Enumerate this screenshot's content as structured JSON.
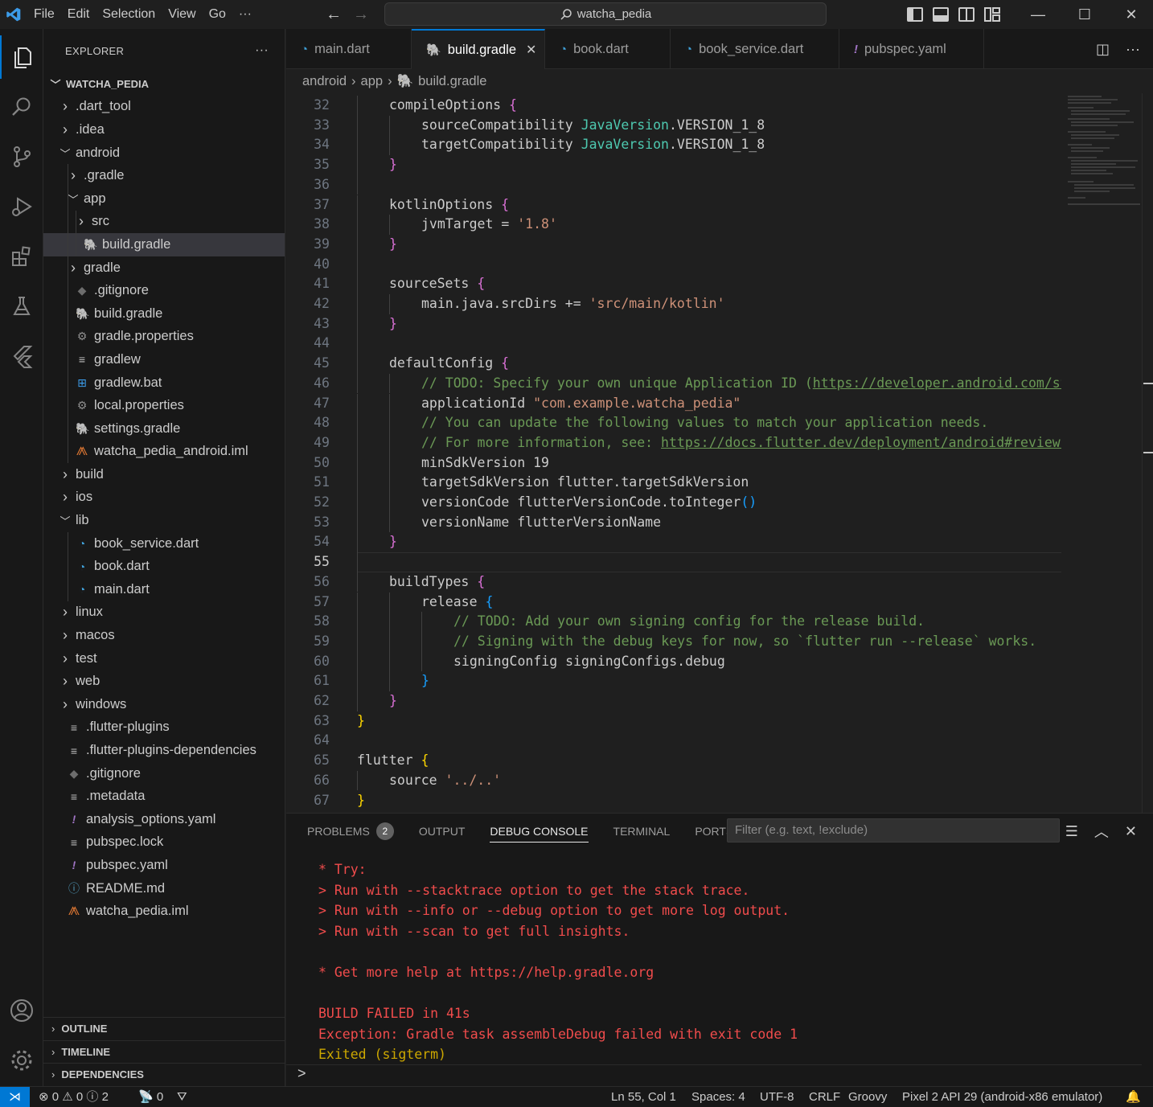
{
  "menu": [
    "File",
    "Edit",
    "Selection",
    "View",
    "Go",
    "···"
  ],
  "search": {
    "text": "watcha_pedia"
  },
  "window": {
    "minimize": "—",
    "maximize": "☐",
    "close": "✕"
  },
  "explorer": {
    "title": "EXPLORER",
    "more": "···",
    "root": "WATCHA_PEDIA"
  },
  "tree": [
    {
      "label": ".dart_tool",
      "depth": 1,
      "type": "folder",
      "open": false
    },
    {
      "label": ".idea",
      "depth": 1,
      "type": "folder",
      "open": false
    },
    {
      "label": "android",
      "depth": 1,
      "type": "folder",
      "open": true
    },
    {
      "label": ".gradle",
      "depth": 2,
      "type": "folder",
      "open": false
    },
    {
      "label": "app",
      "depth": 2,
      "type": "folder",
      "open": true
    },
    {
      "label": "src",
      "depth": 3,
      "type": "folder",
      "open": false
    },
    {
      "label": "build.gradle",
      "depth": 3,
      "type": "gradle",
      "selected": true
    },
    {
      "label": "gradle",
      "depth": 2,
      "type": "folder",
      "open": false
    },
    {
      "label": ".gitignore",
      "depth": 2,
      "type": "git"
    },
    {
      "label": "build.gradle",
      "depth": 2,
      "type": "gradle"
    },
    {
      "label": "gradle.properties",
      "depth": 2,
      "type": "gear"
    },
    {
      "label": "gradlew",
      "depth": 2,
      "type": "lines"
    },
    {
      "label": "gradlew.bat",
      "depth": 2,
      "type": "windows"
    },
    {
      "label": "local.properties",
      "depth": 2,
      "type": "gear"
    },
    {
      "label": "settings.gradle",
      "depth": 2,
      "type": "gradle"
    },
    {
      "label": "watcha_pedia_android.iml",
      "depth": 2,
      "type": "rss"
    },
    {
      "label": "build",
      "depth": 1,
      "type": "folder",
      "open": false
    },
    {
      "label": "ios",
      "depth": 1,
      "type": "folder",
      "open": false
    },
    {
      "label": "lib",
      "depth": 1,
      "type": "folder",
      "open": true
    },
    {
      "label": "book_service.dart",
      "depth": 2,
      "type": "dart"
    },
    {
      "label": "book.dart",
      "depth": 2,
      "type": "dart"
    },
    {
      "label": "main.dart",
      "depth": 2,
      "type": "dart"
    },
    {
      "label": "linux",
      "depth": 1,
      "type": "folder",
      "open": false
    },
    {
      "label": "macos",
      "depth": 1,
      "type": "folder",
      "open": false
    },
    {
      "label": "test",
      "depth": 1,
      "type": "folder",
      "open": false
    },
    {
      "label": "web",
      "depth": 1,
      "type": "folder",
      "open": false
    },
    {
      "label": "windows",
      "depth": 1,
      "type": "folder",
      "open": false
    },
    {
      "label": ".flutter-plugins",
      "depth": 1,
      "type": "lines"
    },
    {
      "label": ".flutter-plugins-dependencies",
      "depth": 1,
      "type": "lines"
    },
    {
      "label": ".gitignore",
      "depth": 1,
      "type": "git"
    },
    {
      "label": ".metadata",
      "depth": 1,
      "type": "lines"
    },
    {
      "label": "analysis_options.yaml",
      "depth": 1,
      "type": "yaml"
    },
    {
      "label": "pubspec.lock",
      "depth": 1,
      "type": "lines"
    },
    {
      "label": "pubspec.yaml",
      "depth": 1,
      "type": "yaml"
    },
    {
      "label": "README.md",
      "depth": 1,
      "type": "info"
    },
    {
      "label": "watcha_pedia.iml",
      "depth": 1,
      "type": "rss"
    }
  ],
  "sections": [
    "OUTLINE",
    "TIMELINE",
    "DEPENDENCIES"
  ],
  "tabs": [
    {
      "label": "main.dart",
      "type": "dart",
      "active": false
    },
    {
      "label": "build.gradle",
      "type": "gradle",
      "active": true
    },
    {
      "label": "book.dart",
      "type": "dart",
      "active": false
    },
    {
      "label": "book_service.dart",
      "type": "dart",
      "active": false
    },
    {
      "label": "pubspec.yaml",
      "type": "yaml",
      "active": false
    }
  ],
  "breadcrumb": [
    "android",
    "app",
    "build.gradle"
  ],
  "editor": {
    "current_line": 55,
    "lines": [
      {
        "n": 32,
        "ind": 1,
        "parts": [
          [
            "k",
            "compileOptions "
          ],
          [
            "b2",
            "{"
          ]
        ]
      },
      {
        "n": 33,
        "ind": 2,
        "parts": [
          [
            "k",
            "sourceCompatibility "
          ],
          [
            "t",
            "JavaVersion"
          ],
          [
            "k",
            ".VERSION_1_8"
          ]
        ]
      },
      {
        "n": 34,
        "ind": 2,
        "parts": [
          [
            "k",
            "targetCompatibility "
          ],
          [
            "t",
            "JavaVersion"
          ],
          [
            "k",
            ".VERSION_1_8"
          ]
        ]
      },
      {
        "n": 35,
        "ind": 1,
        "parts": [
          [
            "b2",
            "}"
          ]
        ]
      },
      {
        "n": 36,
        "ind": 0,
        "parts": []
      },
      {
        "n": 37,
        "ind": 1,
        "parts": [
          [
            "k",
            "kotlinOptions "
          ],
          [
            "b2",
            "{"
          ]
        ]
      },
      {
        "n": 38,
        "ind": 2,
        "parts": [
          [
            "k",
            "jvmTarget = "
          ],
          [
            "s",
            "'1.8'"
          ]
        ]
      },
      {
        "n": 39,
        "ind": 1,
        "parts": [
          [
            "b2",
            "}"
          ]
        ]
      },
      {
        "n": 40,
        "ind": 0,
        "parts": []
      },
      {
        "n": 41,
        "ind": 1,
        "parts": [
          [
            "k",
            "sourceSets "
          ],
          [
            "b2",
            "{"
          ]
        ]
      },
      {
        "n": 42,
        "ind": 2,
        "parts": [
          [
            "k",
            "main.java.srcDirs += "
          ],
          [
            "s",
            "'src/main/kotlin'"
          ]
        ]
      },
      {
        "n": 43,
        "ind": 1,
        "parts": [
          [
            "b2",
            "}"
          ]
        ]
      },
      {
        "n": 44,
        "ind": 0,
        "parts": []
      },
      {
        "n": 45,
        "ind": 1,
        "parts": [
          [
            "k",
            "defaultConfig "
          ],
          [
            "b2",
            "{"
          ]
        ]
      },
      {
        "n": 46,
        "ind": 2,
        "parts": [
          [
            "c",
            "// TODO: Specify your own unique Application ID ("
          ],
          [
            "u",
            "https://developer.android.com/studio/build/application-id.html"
          ],
          [
            "c",
            ")."
          ]
        ]
      },
      {
        "n": 47,
        "ind": 2,
        "parts": [
          [
            "k",
            "applicationId "
          ],
          [
            "s",
            "\"com.example.watcha_pedia\""
          ]
        ]
      },
      {
        "n": 48,
        "ind": 2,
        "parts": [
          [
            "c",
            "// You can update the following values to match your application needs."
          ]
        ]
      },
      {
        "n": 49,
        "ind": 2,
        "parts": [
          [
            "c",
            "// For more information, see: "
          ],
          [
            "u",
            "https://docs.flutter.dev/deployment/android#reviewing-the-gradle-build-configuration"
          ],
          [
            "c",
            "."
          ]
        ]
      },
      {
        "n": 50,
        "ind": 2,
        "parts": [
          [
            "k",
            "minSdkVersion 19"
          ]
        ]
      },
      {
        "n": 51,
        "ind": 2,
        "parts": [
          [
            "k",
            "targetSdkVersion flutter.targetSdkVersion"
          ]
        ]
      },
      {
        "n": 52,
        "ind": 2,
        "parts": [
          [
            "k",
            "versionCode flutterVersionCode.toInteger"
          ],
          [
            "b3",
            "()"
          ]
        ]
      },
      {
        "n": 53,
        "ind": 2,
        "parts": [
          [
            "k",
            "versionName flutterVersionName"
          ]
        ]
      },
      {
        "n": 54,
        "ind": 1,
        "parts": [
          [
            "b2",
            "}"
          ]
        ]
      },
      {
        "n": 55,
        "ind": 0,
        "parts": []
      },
      {
        "n": 56,
        "ind": 1,
        "parts": [
          [
            "k",
            "buildTypes "
          ],
          [
            "b2",
            "{"
          ]
        ]
      },
      {
        "n": 57,
        "ind": 2,
        "parts": [
          [
            "k",
            "release "
          ],
          [
            "b3",
            "{"
          ]
        ]
      },
      {
        "n": 58,
        "ind": 3,
        "parts": [
          [
            "c",
            "// TODO: Add your own signing config for the release build."
          ]
        ]
      },
      {
        "n": 59,
        "ind": 3,
        "parts": [
          [
            "c",
            "// Signing with the debug keys for now, so `flutter run --release` works."
          ]
        ]
      },
      {
        "n": 60,
        "ind": 3,
        "parts": [
          [
            "k",
            "signingConfig signingConfigs.debug"
          ]
        ]
      },
      {
        "n": 61,
        "ind": 2,
        "parts": [
          [
            "b3",
            "}"
          ]
        ]
      },
      {
        "n": 62,
        "ind": 1,
        "parts": [
          [
            "b2",
            "}"
          ]
        ]
      },
      {
        "n": 63,
        "ind": 0,
        "parts": [
          [
            "b1",
            "}"
          ]
        ]
      },
      {
        "n": 64,
        "ind": 0,
        "parts": []
      },
      {
        "n": 65,
        "ind": 0,
        "parts": [
          [
            "k",
            "flutter "
          ],
          [
            "b1",
            "{"
          ]
        ]
      },
      {
        "n": 66,
        "ind": 1,
        "parts": [
          [
            "k",
            "source "
          ],
          [
            "s",
            "'../..'"
          ]
        ]
      },
      {
        "n": 67,
        "ind": 0,
        "parts": [
          [
            "b1",
            "}"
          ]
        ]
      }
    ]
  },
  "panel": {
    "tabs": [
      {
        "label": "PROBLEMS",
        "badge": "2"
      },
      {
        "label": "OUTPUT"
      },
      {
        "label": "DEBUG CONSOLE",
        "active": true
      },
      {
        "label": "TERMINAL"
      },
      {
        "label": "PORTS"
      }
    ],
    "filter_placeholder": "Filter (e.g. text, !exclude)",
    "console": [
      {
        "text": "* Try:",
        "color": "red"
      },
      {
        "text": "> Run with --stacktrace option to get the stack trace.",
        "color": "red"
      },
      {
        "text": "> Run with --info or --debug option to get more log output.",
        "color": "red"
      },
      {
        "text": "> Run with --scan to get full insights.",
        "color": "red"
      },
      {
        "text": "",
        "color": "red"
      },
      {
        "text": "* Get more help at https://help.gradle.org",
        "color": "red"
      },
      {
        "text": "",
        "color": "red"
      },
      {
        "text": "BUILD FAILED in 41s",
        "color": "red"
      },
      {
        "text": "Exception: Gradle task assembleDebug failed with exit code 1",
        "color": "red"
      },
      {
        "text": "Exited (sigterm)",
        "color": "yellow"
      }
    ],
    "prompt": ">"
  },
  "status": {
    "errors": "0",
    "warnings": "0",
    "infos": "2",
    "ports": "0",
    "position": "Ln 55, Col 1",
    "spaces": "Spaces: 4",
    "encoding": "UTF-8",
    "eol": "CRLF",
    "language": "Groovy",
    "device": "Pixel 2 API 29 (android-x86 emulator)"
  },
  "colors": {
    "accent": "#0078d4",
    "error_text": "#f14c4c",
    "exit_text": "#cca700"
  }
}
